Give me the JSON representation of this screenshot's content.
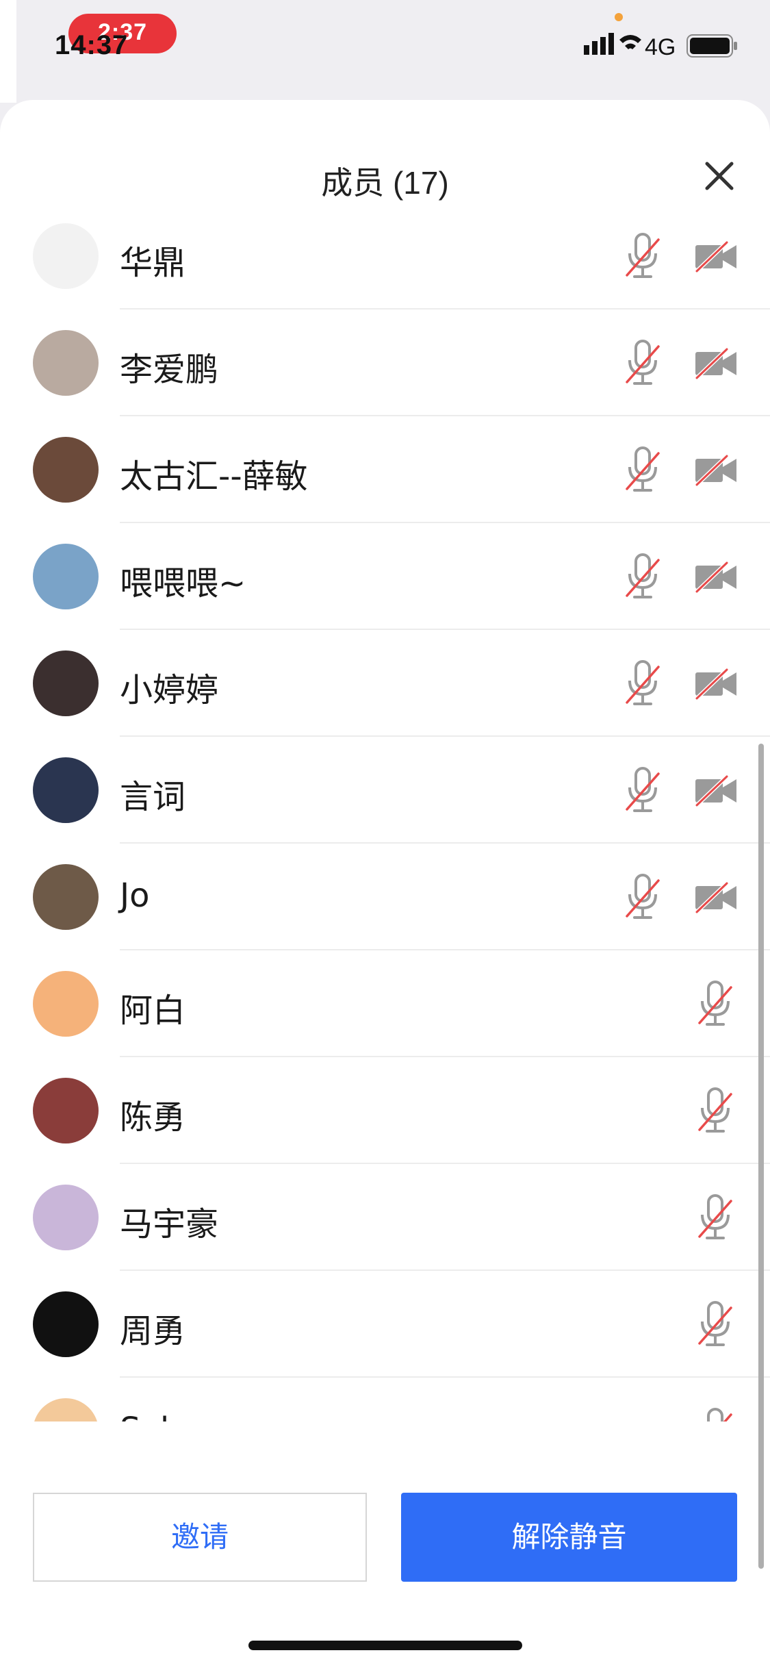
{
  "status_bar": {
    "call_timer": "2:37",
    "clock": "14:37",
    "network": "4G"
  },
  "panel": {
    "title": "成员 (17)",
    "close_icon": "close-icon"
  },
  "members": [
    {
      "name": "华鼎",
      "mic": "muted",
      "camera": "off",
      "avatar_color": "#f2f2f2"
    },
    {
      "name": "李爱鹏",
      "mic": "muted",
      "camera": "off",
      "avatar_color": "#b9aaa0"
    },
    {
      "name": "太古汇--薛敏",
      "mic": "muted",
      "camera": "off",
      "avatar_color": "#6b4a3a"
    },
    {
      "name": "喂喂喂~",
      "mic": "muted",
      "camera": "off",
      "avatar_color": "#7aa3c8"
    },
    {
      "name": "小婷婷",
      "mic": "muted",
      "camera": "off",
      "avatar_color": "#3b2f2f"
    },
    {
      "name": "言词",
      "mic": "muted",
      "camera": "off",
      "avatar_color": "#2a3550"
    },
    {
      "name": "Jo",
      "mic": "muted",
      "camera": "off",
      "avatar_color": "#6e5a48"
    },
    {
      "name": "阿白",
      "mic": "muted",
      "camera": null,
      "avatar_color": "#f5b27a"
    },
    {
      "name": "陈勇",
      "mic": "muted",
      "camera": null,
      "avatar_color": "#8a3d3a"
    },
    {
      "name": "马宇豪",
      "mic": "muted",
      "camera": null,
      "avatar_color": "#c9b6d9"
    },
    {
      "name": "周勇",
      "mic": "muted",
      "camera": null,
      "avatar_color": "#111111"
    },
    {
      "name": "Sylvanas",
      "mic": "muted",
      "camera": null,
      "avatar_color": "#f3c99a"
    }
  ],
  "actions": {
    "invite_label": "邀请",
    "unmute_label": "解除静音"
  },
  "colors": {
    "accent": "#2f6df6",
    "muted_slash": "#e84a4a",
    "icon_gray": "#9a9a9a"
  }
}
